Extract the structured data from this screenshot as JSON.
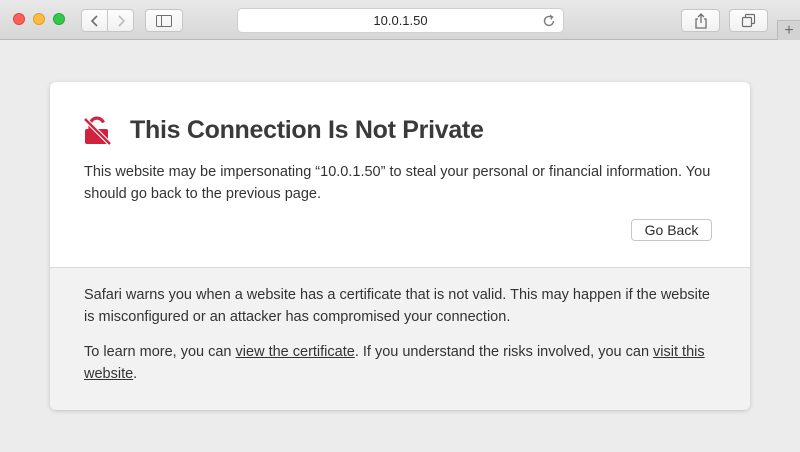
{
  "browser": {
    "address": "10.0.1.50",
    "new_tab_label": "+"
  },
  "colors": {
    "accent_red": "#d0233f",
    "toolbar_bg": "#dcdcdc",
    "page_bg": "#ececec"
  },
  "icons": {
    "back": "chevron-left-icon",
    "forward": "chevron-right-icon",
    "sidebar": "sidebar-icon",
    "reload": "reload-icon",
    "share": "share-icon",
    "tabs": "tabs-overview-icon",
    "warning": "broken-lock-icon"
  },
  "warning": {
    "title": "This Connection Is Not Private",
    "description": "This website may be impersonating “10.0.1.50” to steal your personal or financial information. You should go back to the previous page.",
    "go_back_label": "Go Back"
  },
  "details": {
    "paragraph1": "Safari warns you when a website has a certificate that is not valid. This may happen if the website is misconfigured or an attacker has compromised your connection.",
    "p2_before": "To learn more, you can ",
    "p2_link1": "view the certificate",
    "p2_middle": ". If you understand the risks involved, you can ",
    "p2_link2": "visit this website",
    "p2_after": "."
  }
}
